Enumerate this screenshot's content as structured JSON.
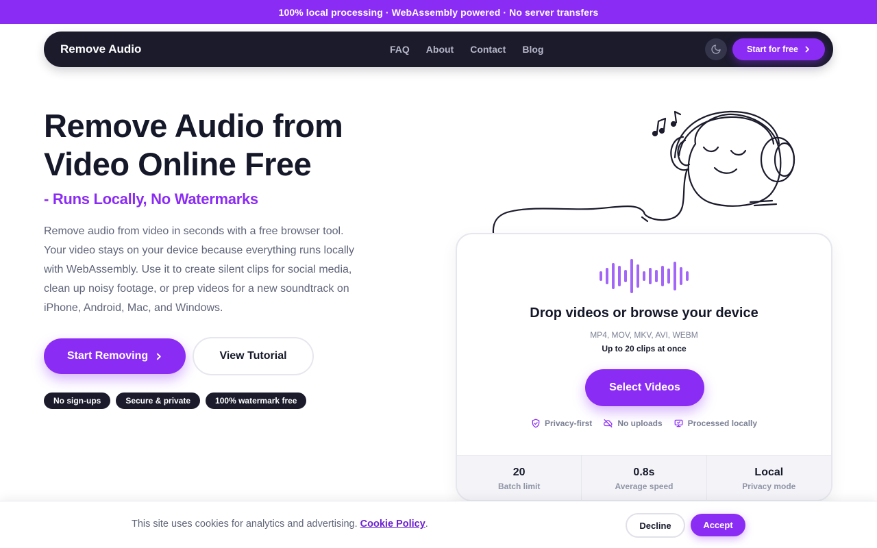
{
  "topbar": {
    "text": "100% local processing · WebAssembly powered · No server transfers"
  },
  "nav": {
    "brand": "Remove Audio",
    "links": [
      "FAQ",
      "About",
      "Contact",
      "Blog"
    ],
    "theme_icon": "moon-icon",
    "cta": "Start for free"
  },
  "hero": {
    "title": "Remove Audio from Video Online Free",
    "subtitle": "- Runs Locally, No Watermarks",
    "description": "Remove audio from video in seconds with a free browser tool. Your video stays on your device because everything runs locally with WebAssembly. Use it to create silent clips for social media, clean up noisy footage, or prep videos for a new soundtrack on iPhone, Android, Mac, and Windows.",
    "primary_button": "Start Removing",
    "secondary_button": "View Tutorial",
    "badges": [
      "No sign-ups",
      "Secure & private",
      "100% watermark free"
    ]
  },
  "upload_card": {
    "title": "Drop videos or browse your device",
    "formats": "MP4, MOV, MKV, AVI, WEBM",
    "limit": "Up to 20 clips at once",
    "button": "Select Videos",
    "features": [
      {
        "icon": "shield-check-icon",
        "label": "Privacy-first"
      },
      {
        "icon": "cloud-off-icon",
        "label": "No uploads"
      },
      {
        "icon": "monitor-check-icon",
        "label": "Processed locally"
      }
    ],
    "stats": [
      {
        "value": "20",
        "label": "Batch limit"
      },
      {
        "value": "0.8s",
        "label": "Average speed"
      },
      {
        "value": "Local",
        "label": "Privacy mode"
      }
    ]
  },
  "cookie": {
    "text": "This site uses cookies for analytics and advertising.",
    "link": "Cookie Policy",
    "period": ".",
    "decline": "Decline",
    "accept": "Accept"
  },
  "colors": {
    "accent": "#8b2cf5",
    "dark": "#1b1b2c",
    "muted": "#5f6478"
  }
}
